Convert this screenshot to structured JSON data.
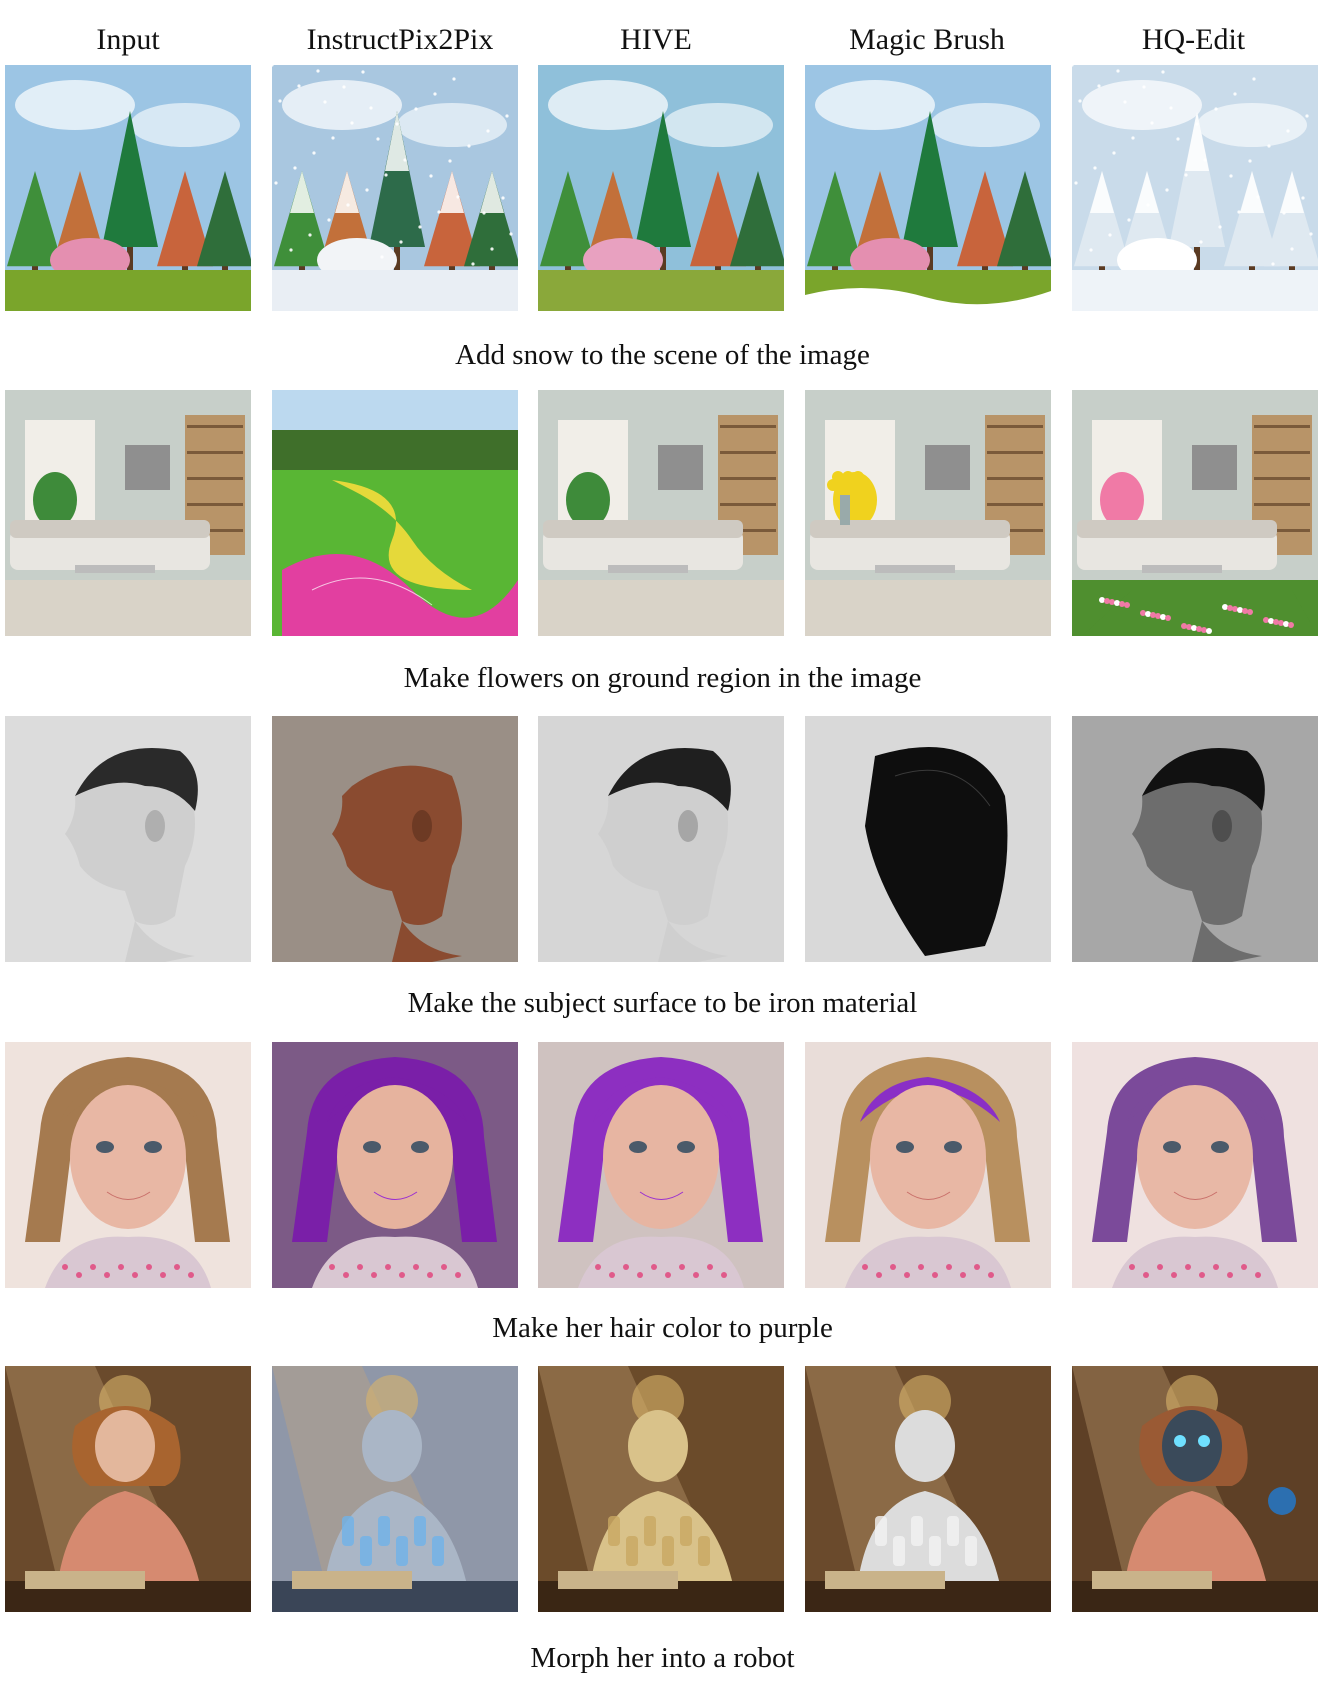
{
  "columns": [
    "Input",
    "InstructPix2Pix",
    "HIVE",
    "Magic Brush",
    "HQ-Edit"
  ],
  "rows": [
    {
      "caption": "Add snow to the scene of the image",
      "scene": "forest",
      "tiles": [
        {
          "variant": "plain",
          "palette": {
            "bg": "#9cc5e4",
            "ground": "#7aa52b",
            "accent": "#e48fb0",
            "main": "#1f7a3d"
          }
        },
        {
          "variant": "snow-heavy",
          "palette": {
            "bg": "#a9c7e0",
            "ground": "#e9eef4",
            "accent": "#f2f4f7",
            "main": "#2d6b4a"
          }
        },
        {
          "variant": "plain",
          "palette": {
            "bg": "#8fc0da",
            "ground": "#8aa83a",
            "accent": "#e8a1c0",
            "main": "#1f7a3d"
          }
        },
        {
          "variant": "snow-light",
          "palette": {
            "bg": "#9cc5e4",
            "ground": "#7aa52b",
            "accent": "#e48fb0",
            "main": "#1f7a3d"
          }
        },
        {
          "variant": "snow-full",
          "palette": {
            "bg": "#c9dbea",
            "ground": "#eef3f8",
            "accent": "#ffffff",
            "main": "#6c8fa6"
          }
        }
      ]
    },
    {
      "caption": "Make flowers on ground region in the image",
      "scene": "room",
      "tiles": [
        {
          "variant": "plain",
          "palette": {
            "bg": "#c7cfc9",
            "ground": "#d9d3c8",
            "accent": "#3e8b3a",
            "main": "#e8e6e1"
          }
        },
        {
          "variant": "park",
          "palette": {
            "bg": "#bcd9ef",
            "ground": "#59b634",
            "accent": "#e23fa0",
            "main": "#e5d93a"
          }
        },
        {
          "variant": "plain",
          "palette": {
            "bg": "#c7cfc9",
            "ground": "#d9d3c8",
            "accent": "#3e8b3a",
            "main": "#e8e6e1"
          }
        },
        {
          "variant": "vase",
          "palette": {
            "bg": "#c7cfc9",
            "ground": "#d9d3c8",
            "accent": "#f0d21e",
            "main": "#e8e6e1"
          }
        },
        {
          "variant": "flower-carpet",
          "palette": {
            "bg": "#c7cfc9",
            "ground": "#4f8f2f",
            "accent": "#f07aa6",
            "main": "#e8e6e1"
          }
        }
      ]
    },
    {
      "caption": "Make the subject surface to be iron material",
      "scene": "head",
      "tiles": [
        {
          "variant": "sketch",
          "palette": {
            "bg": "#dcdcdc",
            "ground": "#9a9a9a",
            "accent": "#2a2a2a",
            "main": "#bdbdbd"
          }
        },
        {
          "variant": "bronze",
          "palette": {
            "bg": "#9a8f86",
            "ground": "#5a2e1c",
            "accent": "#2b150c",
            "main": "#8a4b30"
          }
        },
        {
          "variant": "sketch",
          "palette": {
            "bg": "#d6d6d6",
            "ground": "#8a8a8a",
            "accent": "#1f1f1f",
            "main": "#b0b0b0"
          }
        },
        {
          "variant": "helmet",
          "palette": {
            "bg": "#d9d9d9",
            "ground": "#141414",
            "accent": "#2b2b2b",
            "main": "#0e0e0e"
          }
        },
        {
          "variant": "iron",
          "palette": {
            "bg": "#a7a7a7",
            "ground": "#3a3a3a",
            "accent": "#111111",
            "main": "#6d6d6d"
          }
        }
      ]
    },
    {
      "caption": "Make her hair color to purple",
      "scene": "girl",
      "tiles": [
        {
          "variant": "blonde",
          "palette": {
            "bg": "#efe3dd",
            "ground": "#c29a6e",
            "accent": "#e8b7a4",
            "main": "#a57a4f"
          }
        },
        {
          "variant": "purple",
          "palette": {
            "bg": "#7c5a86",
            "ground": "#8a2fb8",
            "accent": "#e6b39e",
            "main": "#7a1fa8"
          }
        },
        {
          "variant": "purple",
          "palette": {
            "bg": "#cfc2c0",
            "ground": "#9b3ccb",
            "accent": "#e7b5a2",
            "main": "#8d2fc1"
          }
        },
        {
          "variant": "purple-top",
          "palette": {
            "bg": "#e9ddd9",
            "ground": "#b8905f",
            "accent": "#e8b7a4",
            "main": "#8a2fc6"
          }
        },
        {
          "variant": "lavender",
          "palette": {
            "bg": "#efe1e0",
            "ground": "#8b5aa8",
            "accent": "#e8b8a6",
            "main": "#7b4a9a"
          }
        }
      ]
    },
    {
      "caption": "Morph her into a robot",
      "scene": "painting",
      "tiles": [
        {
          "variant": "woman",
          "palette": {
            "bg": "#6a4a2c",
            "ground": "#3b2615",
            "accent": "#e3b79c",
            "main": "#d3907c"
          }
        },
        {
          "variant": "robot-blue",
          "palette": {
            "bg": "#8f97a8",
            "ground": "#3a4557",
            "accent": "#6fb3e8",
            "main": "#aab6c6"
          }
        },
        {
          "variant": "robot-gold",
          "palette": {
            "bg": "#6b4b2a",
            "ground": "#3a2614",
            "accent": "#c8a862",
            "main": "#d9c28a"
          }
        },
        {
          "variant": "robot-white",
          "palette": {
            "bg": "#6a4a2c",
            "ground": "#3b2615",
            "accent": "#f2f2f2",
            "main": "#dcdcdc"
          }
        },
        {
          "variant": "robot-face",
          "palette": {
            "bg": "#5e4026",
            "ground": "#3a2615",
            "accent": "#6fe0ff",
            "main": "#b8734e"
          }
        }
      ]
    }
  ]
}
